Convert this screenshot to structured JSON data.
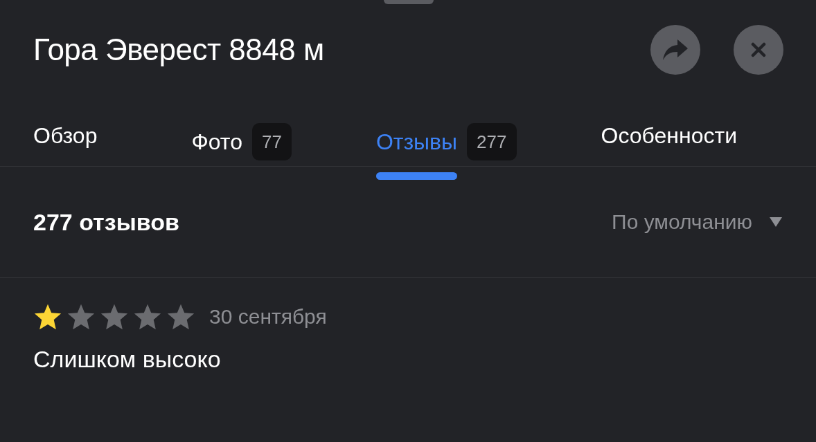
{
  "header": {
    "title": "Гора Эверест 8848 м"
  },
  "tabs": [
    {
      "label": "Обзор",
      "selected": false
    },
    {
      "label": "Фото",
      "count": "77",
      "selected": false
    },
    {
      "label": "Отзывы",
      "count": "277",
      "selected": true
    },
    {
      "label": "Особенности",
      "selected": false
    }
  ],
  "reviews_header": {
    "count_label": "277 отзывов",
    "sort": "По умолчанию"
  },
  "review": {
    "stars": 1,
    "date": "30 сентября",
    "text": "Слишком высоко"
  }
}
